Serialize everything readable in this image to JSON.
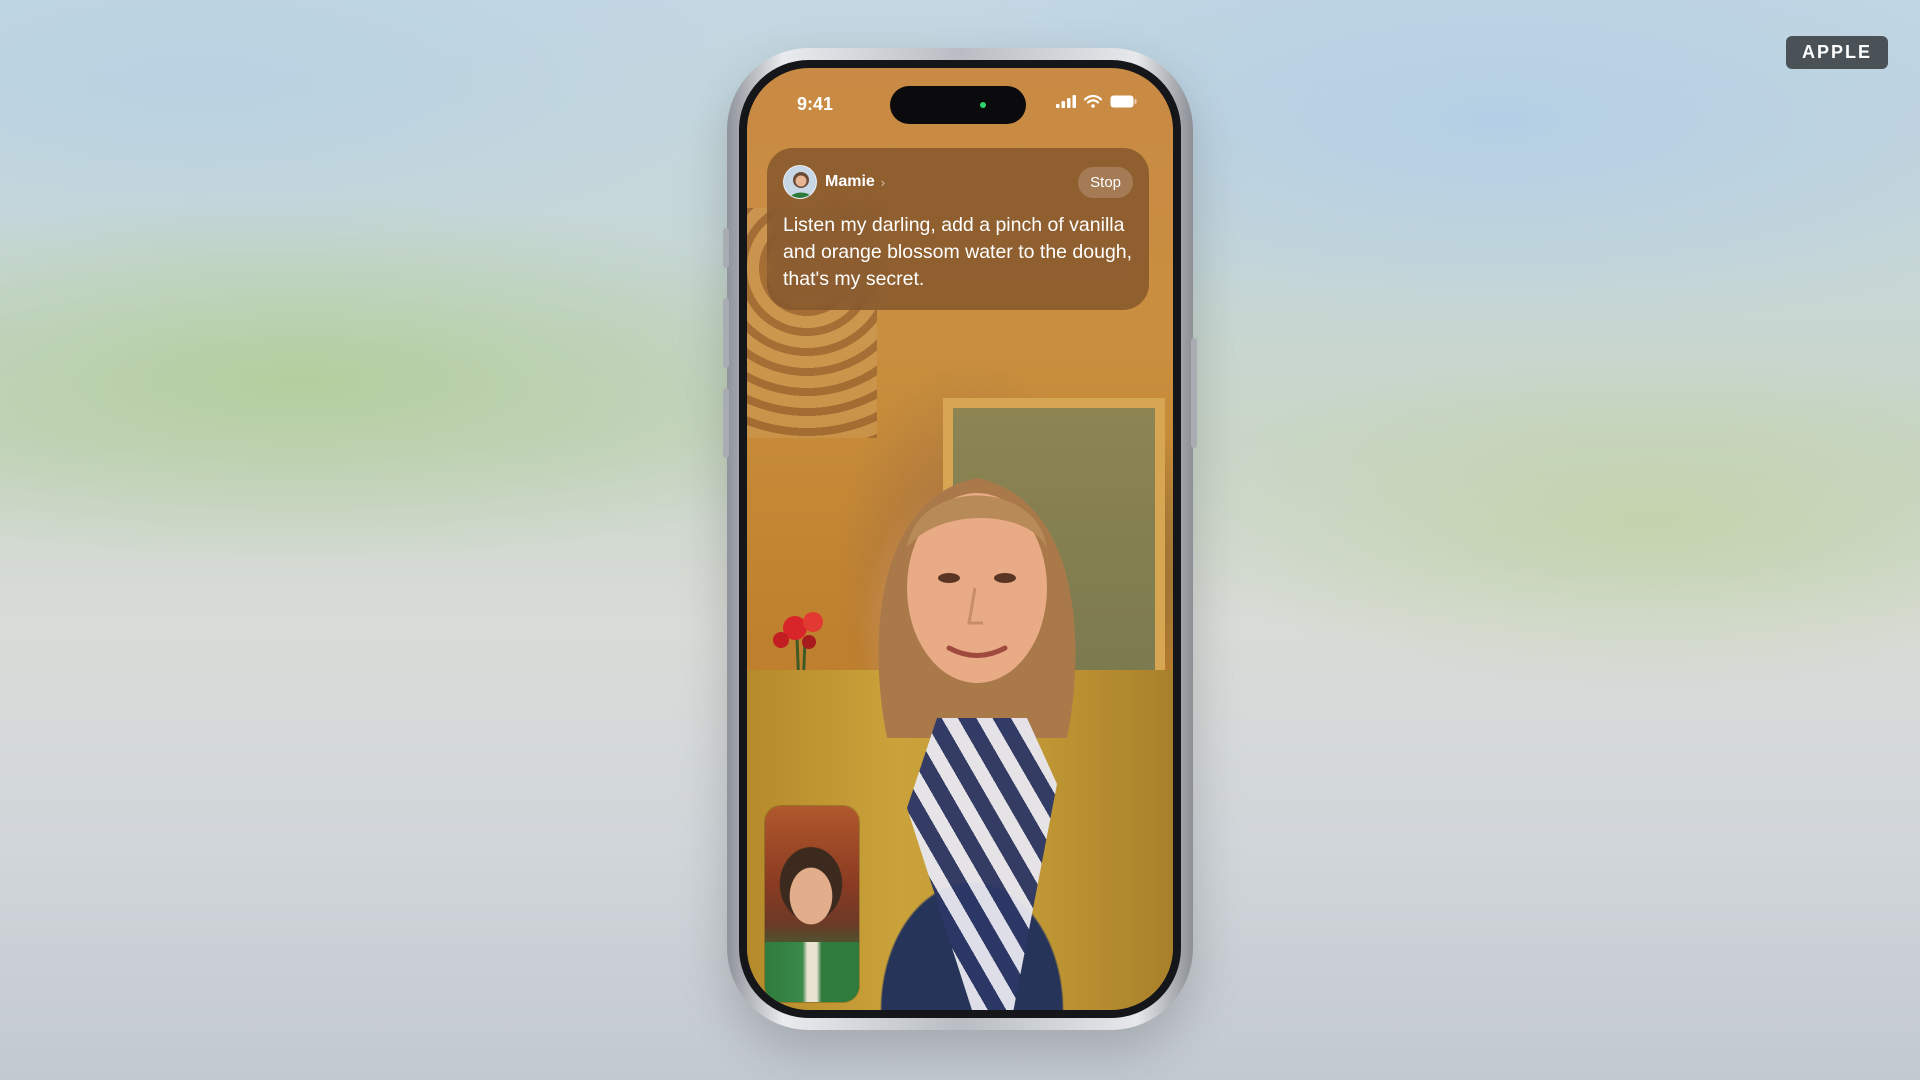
{
  "watermark": {
    "label": "APPLE"
  },
  "status_bar": {
    "time": "9:41",
    "icons": [
      "cellular-signal-icon",
      "wifi-icon",
      "battery-icon"
    ]
  },
  "caption": {
    "speaker": "Mamie",
    "stop_label": "Stop",
    "text": "Listen my darling, add a pinch of vanilla and orange blossom water to the dough, that's my secret."
  },
  "colors": {
    "caption_bg": "#7a4f28",
    "badge_bg": "#4a5258"
  }
}
